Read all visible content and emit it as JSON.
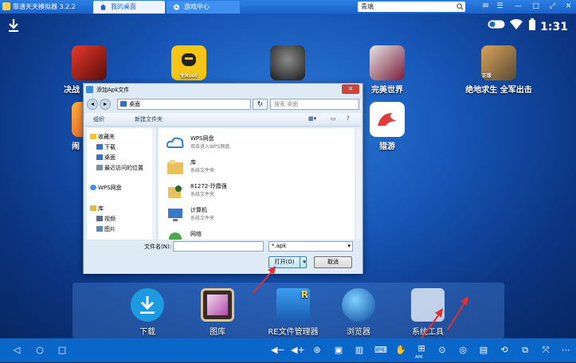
{
  "window": {
    "title": "靠谱天天模拟器 3.2.2"
  },
  "tabs": [
    {
      "label": "我的桌面"
    },
    {
      "label": "游戏中心"
    }
  ],
  "search": {
    "value": "青璃"
  },
  "status": {
    "time": "1:31"
  },
  "apps": [
    {
      "label": "决战"
    },
    {
      "label": ""
    },
    {
      "label": ""
    },
    {
      "label": "完美世界"
    },
    {
      "label": "绝地求生 全军出击"
    },
    {
      "label": "闹"
    },
    {
      "label": "猎游"
    }
  ],
  "app_badges": {
    "root": "免Root",
    "pubg": "正版"
  },
  "dock": [
    {
      "label": "下载"
    },
    {
      "label": "图库"
    },
    {
      "label": "RE文件管理器"
    },
    {
      "label": "浏览器"
    },
    {
      "label": "系统工具"
    }
  ],
  "dialog": {
    "title": "添加Apk文件",
    "address": "桌面",
    "search_placeholder": "搜索 桌面",
    "toolbar": {
      "organize": "组织",
      "new_folder": "新建文件夹"
    },
    "nav": [
      {
        "label": "收藏夹"
      },
      {
        "label": "下载"
      },
      {
        "label": "桌面"
      },
      {
        "label": "最近访问的位置"
      },
      {
        "label": "WPS网盘"
      },
      {
        "label": "库"
      },
      {
        "label": "视频"
      },
      {
        "label": "图片"
      }
    ],
    "files": [
      {
        "name": "WPS网盘",
        "sub": "双击进入WPS网盘"
      },
      {
        "name": "库",
        "sub": "系统文件夹"
      },
      {
        "name": "81272-玲霞强",
        "sub": "系统文件夹"
      },
      {
        "name": "计算机",
        "sub": "系统文件夹"
      },
      {
        "name": "网络",
        "sub": ""
      }
    ],
    "filename_label": "文件名(N):",
    "filename_value": "",
    "filter": "*.apk",
    "open_label": "打开(O)",
    "cancel_label": "取消"
  },
  "navbar": {
    "apk_label": "APK"
  }
}
